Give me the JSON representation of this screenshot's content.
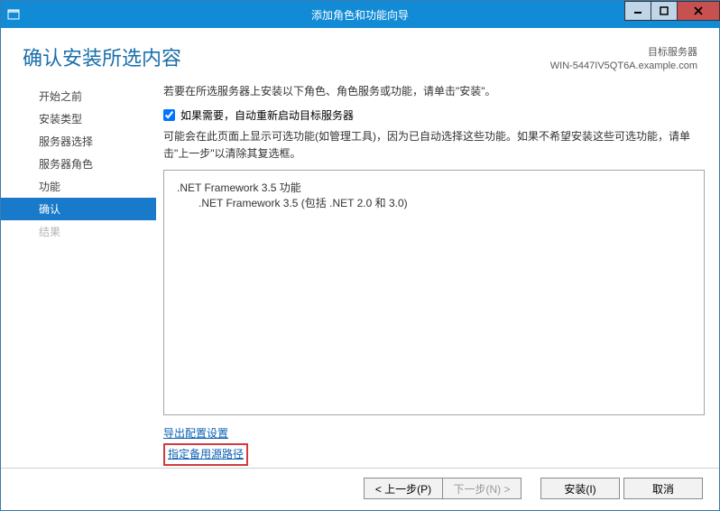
{
  "titlebar": {
    "title": "添加角色和功能向导"
  },
  "header": {
    "page_title": "确认安装所选内容",
    "dest_label": "目标服务器",
    "dest_server": "WIN-5447IV5QT6A.example.com"
  },
  "sidebar": {
    "items": [
      {
        "label": "开始之前",
        "state": "normal"
      },
      {
        "label": "安装类型",
        "state": "normal"
      },
      {
        "label": "服务器选择",
        "state": "normal"
      },
      {
        "label": "服务器角色",
        "state": "normal"
      },
      {
        "label": "功能",
        "state": "normal"
      },
      {
        "label": "确认",
        "state": "active"
      },
      {
        "label": "结果",
        "state": "disabled"
      }
    ]
  },
  "main": {
    "intro": "若要在所选服务器上安装以下角色、角色服务或功能，请单击\"安装\"。",
    "restart_checkbox_label": "如果需要，自动重新启动目标服务器",
    "restart_checked": true,
    "note": "可能会在此页面上显示可选功能(如管理工具)，因为已自动选择这些功能。如果不希望安装这些可选功能，请单击\"上一步\"以清除其复选框。",
    "features": [
      {
        "text": ".NET Framework 3.5 功能",
        "indent": 0
      },
      {
        "text": ".NET Framework 3.5 (包括 .NET 2.0 和 3.0)",
        "indent": 1
      }
    ],
    "export_link": "导出配置设置",
    "alt_source_link": "指定备用源路径"
  },
  "buttons": {
    "prev": "< 上一步(P)",
    "next": "下一步(N) >",
    "install": "安装(I)",
    "cancel": "取消"
  }
}
